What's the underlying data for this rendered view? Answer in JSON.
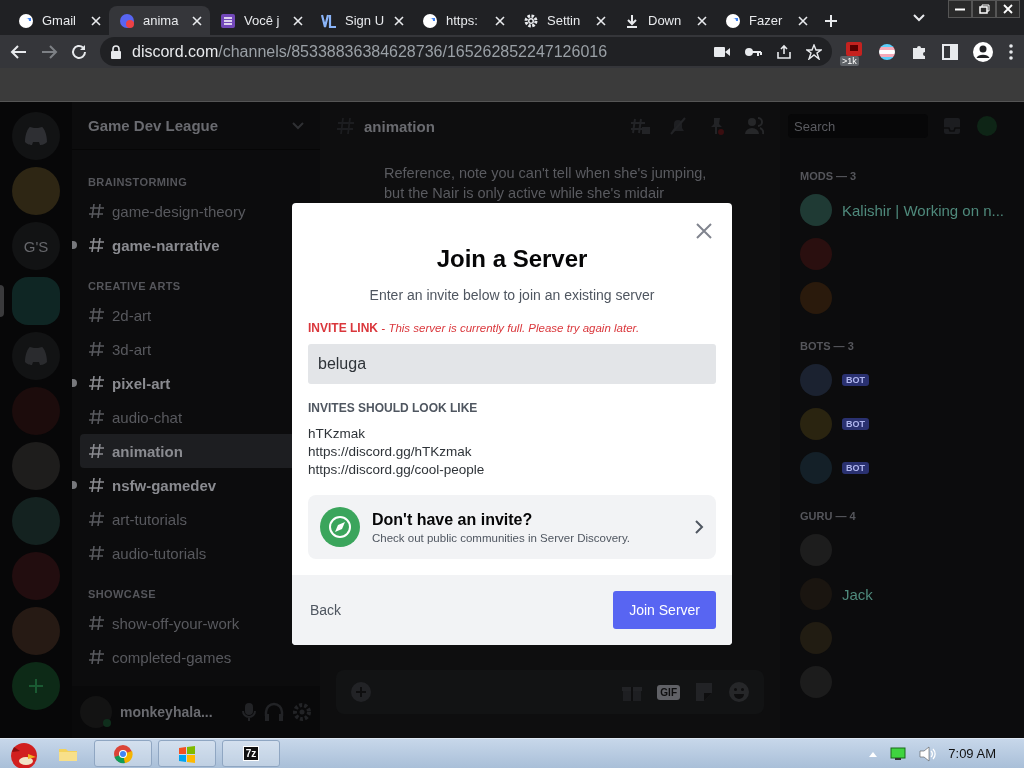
{
  "browser": {
    "tabs": [
      {
        "title": "Gmail",
        "kind": "google",
        "selected": false
      },
      {
        "title": "anima",
        "kind": "discord",
        "selected": true
      },
      {
        "title": "Você j",
        "kind": "list",
        "selected": false
      },
      {
        "title": "Sign U",
        "kind": "vl",
        "selected": false
      },
      {
        "title": "https:",
        "kind": "google",
        "selected": false
      },
      {
        "title": "Settin",
        "kind": "gear",
        "selected": false
      },
      {
        "title": "Down",
        "kind": "download",
        "selected": false
      },
      {
        "title": "Fazer",
        "kind": "google",
        "selected": false
      }
    ],
    "address": {
      "host": "discord.com",
      "path": "/channels/85338836384628736/165262852247126016"
    },
    "extension_badge": ">1k"
  },
  "server_rail": {
    "items": [
      {
        "kind": "home"
      },
      {
        "kind": "avatar",
        "color": "#2e2614",
        "selected": false
      },
      {
        "kind": "text",
        "label": "G'S",
        "selected": false
      },
      {
        "kind": "avatar",
        "color": "#0f2624",
        "selected": true
      },
      {
        "kind": "discord",
        "selected": false
      },
      {
        "kind": "avatar",
        "color": "#1c0c0c",
        "selected": false
      },
      {
        "kind": "avatar",
        "color": "#1e1d1c",
        "selected": false
      },
      {
        "kind": "avatar",
        "color": "#142220",
        "selected": false
      },
      {
        "kind": "avatar",
        "color": "#220d0f",
        "selected": false
      },
      {
        "kind": "avatar",
        "color": "#261a14",
        "selected": false
      },
      {
        "kind": "add"
      }
    ]
  },
  "channel_sidebar": {
    "server_name": "Game Dev League",
    "categories": [
      {
        "name": "BRAINSTORMING",
        "channels": [
          {
            "name": "game-design-theory",
            "unread": false,
            "selected": false
          },
          {
            "name": "game-narrative",
            "unread": true,
            "selected": false
          }
        ]
      },
      {
        "name": "CREATIVE ARTS",
        "channels": [
          {
            "name": "2d-art",
            "unread": false,
            "selected": false
          },
          {
            "name": "3d-art",
            "unread": false,
            "selected": false
          },
          {
            "name": "pixel-art",
            "unread": true,
            "selected": false
          },
          {
            "name": "audio-chat",
            "unread": false,
            "selected": false
          },
          {
            "name": "animation",
            "unread": false,
            "selected": true
          },
          {
            "name": "nsfw-gamedev",
            "unread": true,
            "selected": false
          },
          {
            "name": "art-tutorials",
            "unread": false,
            "selected": false
          },
          {
            "name": "audio-tutorials",
            "unread": false,
            "selected": false
          }
        ]
      },
      {
        "name": "SHOWCASE",
        "channels": [
          {
            "name": "show-off-your-work",
            "unread": false,
            "selected": false
          },
          {
            "name": "completed-games",
            "unread": false,
            "selected": false
          }
        ]
      }
    ],
    "user": {
      "name": "monkeyhala..."
    }
  },
  "chat": {
    "channel": "animation",
    "search_placeholder": "Search",
    "message": "Reference, note you can't tell when she's jumping, but the Nair is only active while she's midair",
    "gif_label": "GIF"
  },
  "members": {
    "groups": [
      {
        "title": "MODS — 3",
        "members": [
          {
            "name": "Kalishir | Working on n...",
            "color": "#1f3a34"
          },
          {
            "color": "#2a0f0f"
          },
          {
            "color": "#2a1a0c"
          }
        ]
      },
      {
        "title": "BOTS — 3",
        "members": [
          {
            "tag": "BOT",
            "color": "#1b2230"
          },
          {
            "tag": "BOT",
            "color": "#2a2410"
          },
          {
            "tag": "BOT",
            "color": "#142028"
          }
        ]
      },
      {
        "title": "GURU — 4",
        "members": [
          {
            "color": "#1d1d1d"
          },
          {
            "name": "Jack",
            "color": "#1a1510"
          },
          {
            "color": "#211c12"
          },
          {
            "color": "#1c1c1c"
          }
        ]
      }
    ]
  },
  "modal": {
    "title": "Join a Server",
    "subtitle": "Enter an invite below to join an existing server",
    "error_label": "INVITE LINK",
    "error_message": "- This server is currently full. Please try again later.",
    "input_value": "beluga",
    "examples_heading": "INVITES SHOULD LOOK LIKE",
    "examples": [
      "hTKzmak",
      "https://discord.gg/hTKzmak",
      "https://discord.gg/cool-people"
    ],
    "discovery": {
      "title": "Don't have an invite?",
      "subtitle": "Check out public communities in Server Discovery."
    },
    "back": "Back",
    "submit": "Join Server"
  },
  "taskbar": {
    "apps": [
      {
        "kind": "folder"
      },
      {
        "kind": "chrome"
      },
      {
        "kind": "windows"
      },
      {
        "kind": "label",
        "label": "7z"
      }
    ],
    "clock": "7:09 AM"
  }
}
